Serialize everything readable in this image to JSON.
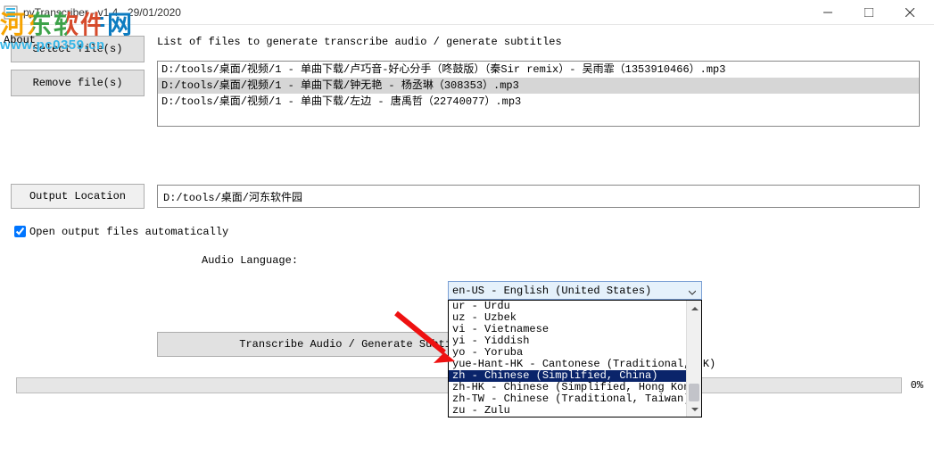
{
  "window": {
    "title": "pyTranscriber - v1.4 - 29/01/2020"
  },
  "watermark": {
    "text": "河东软件网",
    "url": "www.pc0359.cn"
  },
  "about": "About",
  "buttons": {
    "select_files": "Select file(s)",
    "remove_files": "Remove file(s)",
    "output_location": "Output Location",
    "transcribe": "Transcribe Audio / Generate Subtitles"
  },
  "file_list": {
    "caption": "List of files to generate transcribe audio / generate subtitles",
    "items": [
      {
        "path": "D:/tools/桌面/视频/1 - 单曲下载/卢巧音-好心分手（咚鼓版）（秦Sir remix）- 吴雨霏（1353910466）.mp3",
        "selected": false
      },
      {
        "path": "D:/tools/桌面/视频/1 - 单曲下载/钟无艳 - 杨丞琳（308353）.mp3",
        "selected": true
      },
      {
        "path": "D:/tools/桌面/视频/1 - 单曲下载/左边 - 唐禹哲（22740077）.mp3",
        "selected": false
      }
    ]
  },
  "output_path": "D:/tools/桌面/河东软件园",
  "open_output": {
    "checked": true,
    "label": "Open output files automatically"
  },
  "language": {
    "label": "Audio Language:",
    "selected": "en-US - English (United States)",
    "options": [
      {
        "text": "ur - Urdu"
      },
      {
        "text": "uz - Uzbek"
      },
      {
        "text": "vi - Vietnamese"
      },
      {
        "text": "yi - Yiddish"
      },
      {
        "text": "yo - Yoruba"
      },
      {
        "text": "yue-Hant-HK - Cantonese (Traditional, HK)"
      },
      {
        "text": "zh - Chinese (Simplified, China)",
        "highlight": true
      },
      {
        "text": "zh-HK - Chinese (Simplified, Hong Kong)"
      },
      {
        "text": "zh-TW - Chinese (Traditional, Taiwan)"
      },
      {
        "text": "zu - Zulu"
      }
    ]
  },
  "progress": {
    "percent": "0%"
  }
}
